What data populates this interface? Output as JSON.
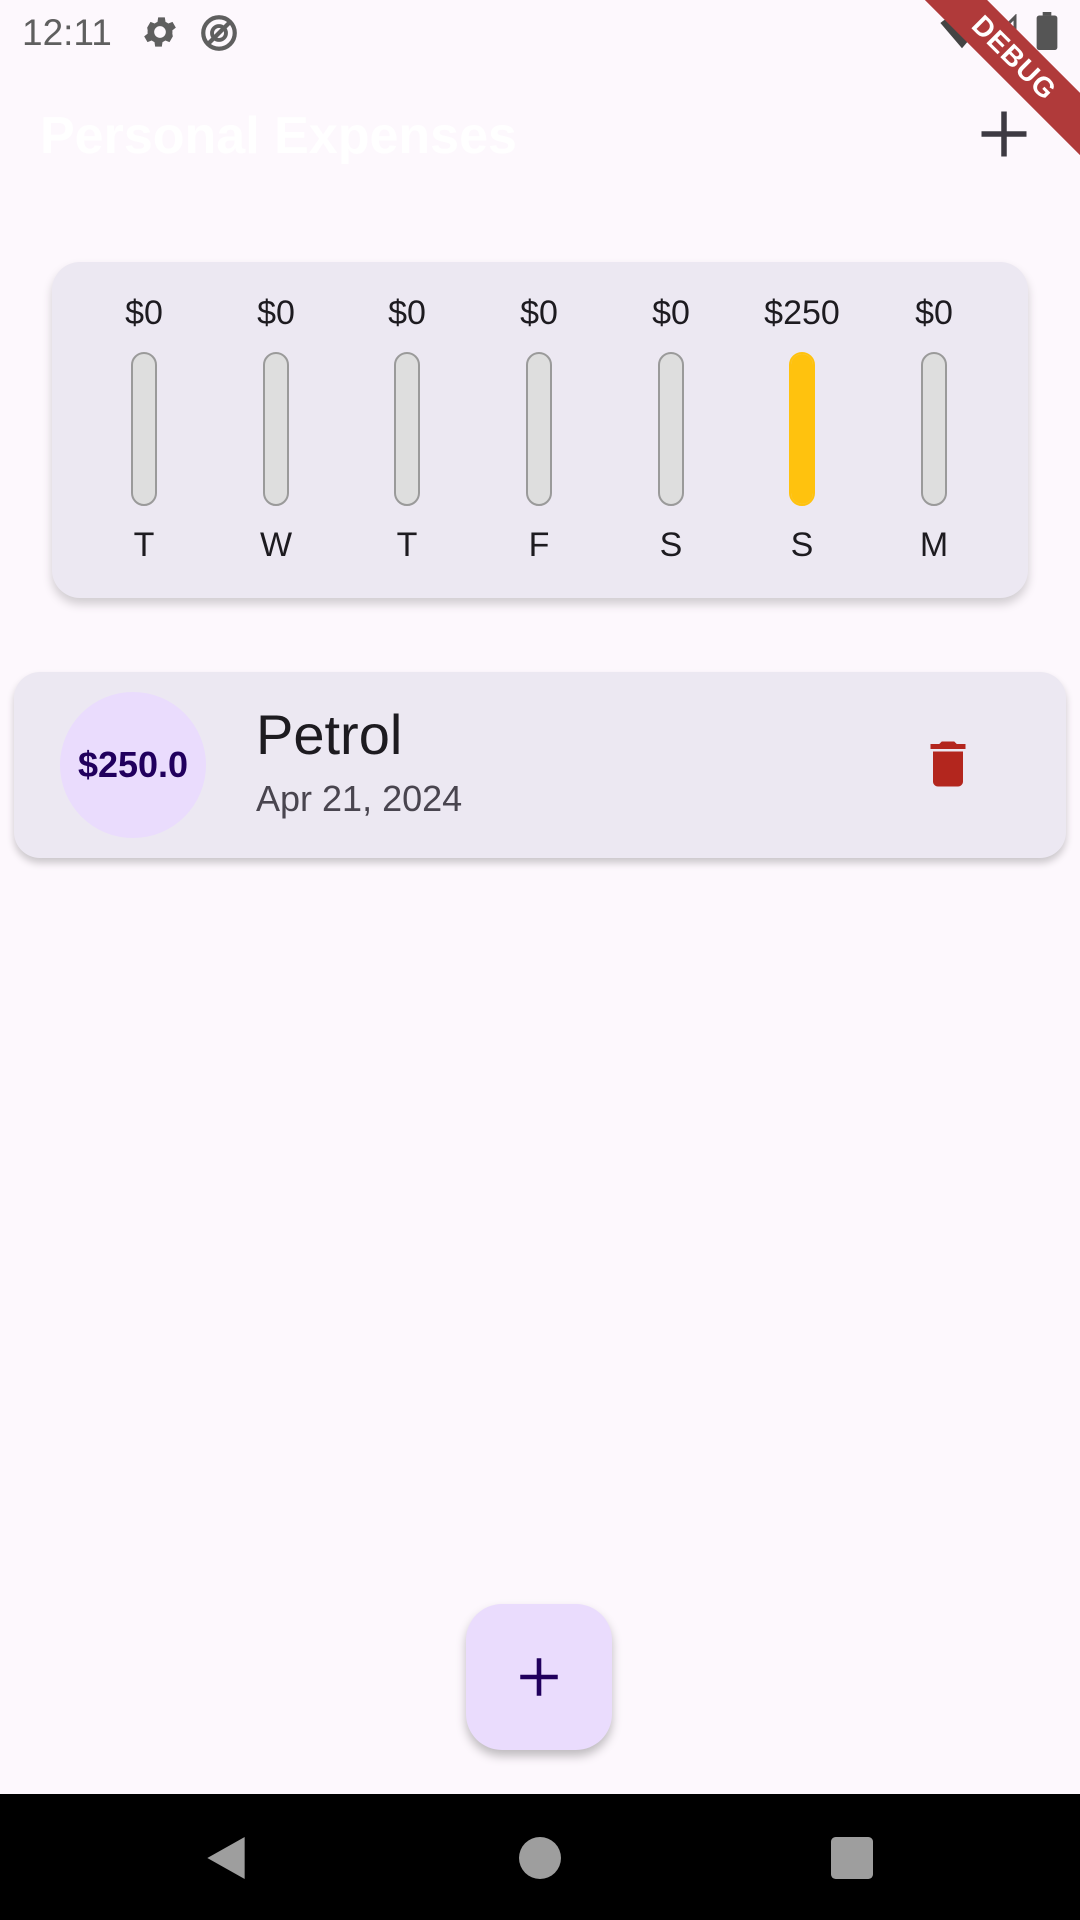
{
  "status_bar": {
    "time": "12:11",
    "icons": [
      "gear-icon",
      "do-not-disturb-icon",
      "wifi-icon",
      "signal-icon",
      "battery-icon"
    ],
    "debug_banner": "DEBUG"
  },
  "app_bar": {
    "title": "Personal Expenses",
    "add_icon": "plus-icon"
  },
  "chart": {
    "fill_color": "#ffc20e",
    "bars": [
      {
        "day": "T",
        "amount": "$0",
        "fraction": 0
      },
      {
        "day": "W",
        "amount": "$0",
        "fraction": 0
      },
      {
        "day": "T",
        "amount": "$0",
        "fraction": 0
      },
      {
        "day": "F",
        "amount": "$0",
        "fraction": 0
      },
      {
        "day": "S",
        "amount": "$0",
        "fraction": 0
      },
      {
        "day": "S",
        "amount": "$250",
        "fraction": 1
      },
      {
        "day": "M",
        "amount": "$0",
        "fraction": 0
      }
    ]
  },
  "transactions": [
    {
      "amount": "$250.0",
      "title": "Petrol",
      "date": "Apr 21, 2024",
      "delete_icon": "trash-icon",
      "delete_color": "#b3261e"
    }
  ],
  "fab": {
    "icon": "plus-icon"
  },
  "nav_bar": {
    "icons": [
      "back-icon",
      "home-icon",
      "recents-icon"
    ]
  }
}
